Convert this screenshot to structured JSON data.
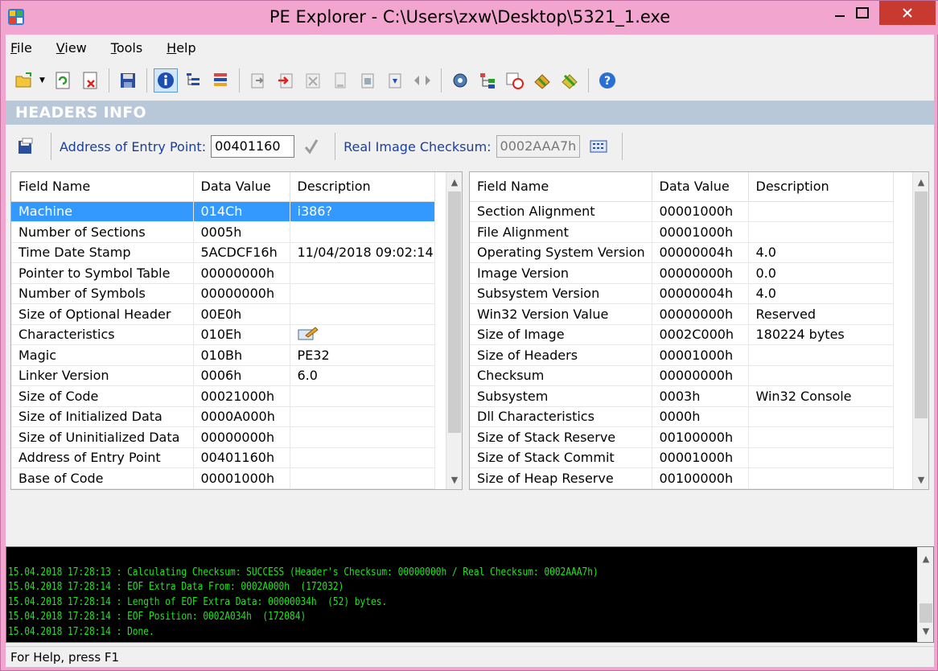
{
  "window": {
    "title": "PE Explorer - C:\\Users\\zxw\\Desktop\\5321_1.exe"
  },
  "menu": {
    "items": [
      {
        "label": "File",
        "accel": "F",
        "rest": "ile"
      },
      {
        "label": "View",
        "accel": "V",
        "rest": "iew"
      },
      {
        "label": "Tools",
        "accel": "T",
        "rest": "ools"
      },
      {
        "label": "Help",
        "accel": "H",
        "rest": "elp"
      }
    ]
  },
  "section": {
    "title": "HEADERS INFO"
  },
  "addressbar": {
    "entry_label": "Address of Entry Point:",
    "entry_value": "00401160",
    "checksum_label": "Real Image Checksum:",
    "checksum_value": "0002AAA7h"
  },
  "left_table": {
    "headers": [
      "Field Name",
      "Data Value",
      "Description"
    ],
    "rows": [
      [
        "Machine",
        "014Ch",
        "i386?"
      ],
      [
        "Number of Sections",
        "0005h",
        ""
      ],
      [
        "Time Date Stamp",
        "5ACDCF16h",
        "11/04/2018  09:02:14"
      ],
      [
        "Pointer to Symbol Table",
        "00000000h",
        ""
      ],
      [
        "Number of Symbols",
        "00000000h",
        ""
      ],
      [
        "Size of Optional Header",
        "00E0h",
        ""
      ],
      [
        "Characteristics",
        "010Eh",
        ""
      ],
      [
        "Magic",
        "010Bh",
        "PE32"
      ],
      [
        "Linker Version",
        "0006h",
        "6.0"
      ],
      [
        "Size of Code",
        "00021000h",
        ""
      ],
      [
        "Size of Initialized Data",
        "0000A000h",
        ""
      ],
      [
        "Size of Uninitialized Data",
        "00000000h",
        ""
      ],
      [
        "Address of Entry Point",
        "00401160h",
        ""
      ],
      [
        "Base of Code",
        "00001000h",
        ""
      ]
    ]
  },
  "right_table": {
    "headers": [
      "Field Name",
      "Data Value",
      "Description"
    ],
    "rows": [
      [
        "Section Alignment",
        "00001000h",
        ""
      ],
      [
        "File Alignment",
        "00001000h",
        ""
      ],
      [
        "Operating System Version",
        "00000004h",
        "4.0"
      ],
      [
        "Image Version",
        "00000000h",
        "0.0"
      ],
      [
        "Subsystem Version",
        "00000004h",
        "4.0"
      ],
      [
        "Win32 Version Value",
        "00000000h",
        "Reserved"
      ],
      [
        "Size of Image",
        "0002C000h",
        "180224 bytes"
      ],
      [
        "Size of Headers",
        "00001000h",
        ""
      ],
      [
        "Checksum",
        "00000000h",
        ""
      ],
      [
        "Subsystem",
        "0003h",
        "Win32 Console"
      ],
      [
        "Dll Characteristics",
        "0000h",
        ""
      ],
      [
        "Size of Stack Reserve",
        "00100000h",
        ""
      ],
      [
        "Size of Stack Commit",
        "00001000h",
        ""
      ],
      [
        "Size of Heap Reserve",
        "00100000h",
        ""
      ]
    ]
  },
  "log": {
    "lines": [
      "15.04.2018 17:28:13 : Calculating Checksum: SUCCESS (Header's Checksum: 00000000h / Real Checksum: 0002AAA7h)",
      "15.04.2018 17:28:14 : EOF Extra Data From: 0002A000h  (172032)",
      "15.04.2018 17:28:14 : Length of EOF Extra Data: 00000034h  (52) bytes.",
      "15.04.2018 17:28:14 : EOF Position: 0002A034h  (172084)",
      "15.04.2018 17:28:14 : Done."
    ]
  },
  "status": {
    "text": "For Help, press F1"
  },
  "colors": {
    "frame": "#f2a5cf",
    "close_button": "#c8392f",
    "selection": "#3399ff",
    "section_header": "#b8c8d8",
    "log_text": "#22e322"
  }
}
